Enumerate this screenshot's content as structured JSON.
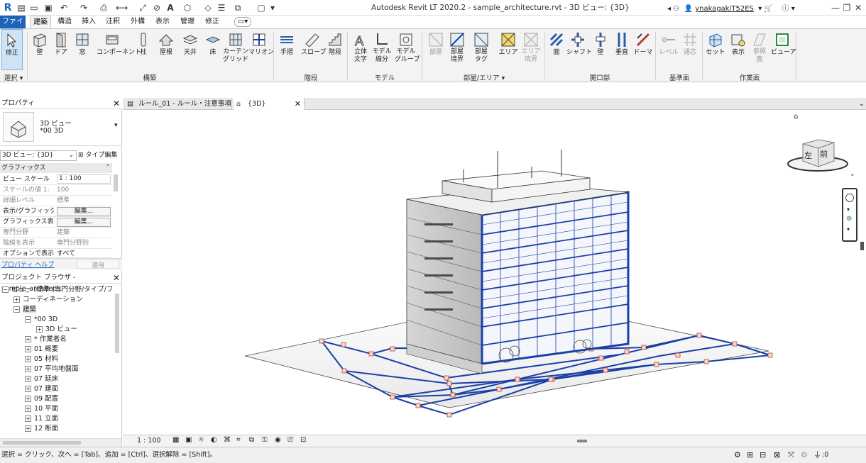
{
  "titlebar": {
    "app_title": "Autodesk Revit LT 2020.2 - sample_architecture.rvt - 3D ビュー: {3D}",
    "user_name": "ynakagakiT52ES"
  },
  "ribbon_tabs": [
    "ファイル",
    "建築",
    "構造",
    "挿入",
    "注釈",
    "外構",
    "表示",
    "管理",
    "修正"
  ],
  "ribbon": {
    "select": {
      "label": "修正",
      "panel": "選択"
    },
    "build": {
      "panel": "構築",
      "buttons": [
        "壁",
        "ドア",
        "窓",
        "コンポーネント",
        "柱",
        "屋根",
        "天井",
        "床",
        "カーテン\nグリッド",
        "マリオン"
      ]
    },
    "circulation": {
      "panel": "階段",
      "buttons": [
        "手摺",
        "スロープ",
        "階段"
      ]
    },
    "model": {
      "panel": "モデル",
      "buttons": [
        "立体\n文字",
        "モデル\n線分",
        "モデル\nグループ"
      ]
    },
    "room": {
      "panel": "部屋/エリア",
      "buttons": [
        "部屋",
        "部屋\n境界",
        "部屋\nタグ",
        "エリア",
        "エリア\n境界"
      ]
    },
    "opening": {
      "panel": "開口部",
      "buttons": [
        "面",
        "シャフト",
        "壁",
        "垂直",
        "ドーマ"
      ]
    },
    "datum": {
      "panel": "基準面",
      "buttons": [
        "レベル",
        "通芯"
      ]
    },
    "workplane": {
      "panel": "作業面",
      "buttons": [
        "セット",
        "表示",
        "参照\n面",
        "ビューア"
      ]
    }
  },
  "properties": {
    "title": "プロパティ",
    "type_name_line1": "3D ビュー",
    "type_name_line2": "*00 3D",
    "view_selector": "3D ビュー: {3D}",
    "edit_type": "タイプ編集",
    "section": "グラフィックス",
    "rows": [
      {
        "key": "ビュー スケール",
        "value": "1 : 100"
      },
      {
        "key": "スケールの値   1:",
        "value": "100"
      },
      {
        "key": "詳細レベル",
        "value": "標準"
      },
      {
        "key": "表示/グラフィック...",
        "value": "編集..."
      },
      {
        "key": "グラフィックス表示...",
        "value": "編集..."
      },
      {
        "key": "専門分野",
        "value": "建築"
      },
      {
        "key": "陰線を表示",
        "value": "専門分野別"
      },
      {
        "key": "オプションで表示",
        "value": "すべて"
      }
    ],
    "help_link": "プロパティ ヘルプ",
    "apply": "適用"
  },
  "browser": {
    "title": "プロジェクト ブラウザ - sample_architec...",
    "items": [
      {
        "label": "ビュー (標準 (専門分野/タイプ/フ",
        "level": 0,
        "toggle": "-"
      },
      {
        "label": "コーディネーション",
        "level": 1,
        "toggle": "+"
      },
      {
        "label": "建築",
        "level": 1,
        "toggle": "-"
      },
      {
        "label": "*00 3D",
        "level": 2,
        "toggle": "-"
      },
      {
        "label": "3D ビュー",
        "level": 3,
        "toggle": "+"
      },
      {
        "label": "* 作業者名",
        "level": 2,
        "toggle": "+"
      },
      {
        "label": "01 概要",
        "level": 2,
        "toggle": "+"
      },
      {
        "label": "05 材料",
        "level": 2,
        "toggle": "+"
      },
      {
        "label": "07 平均地盤面",
        "level": 2,
        "toggle": "+"
      },
      {
        "label": "07 延床",
        "level": 2,
        "toggle": "+"
      },
      {
        "label": "07 建面",
        "level": 2,
        "toggle": "+"
      },
      {
        "label": "09 配置",
        "level": 2,
        "toggle": "+"
      },
      {
        "label": "10 平面",
        "level": 2,
        "toggle": "+"
      },
      {
        "label": "11 立面",
        "level": 2,
        "toggle": "+"
      },
      {
        "label": "12 断面",
        "level": 2,
        "toggle": "+"
      }
    ]
  },
  "view_tabs": [
    {
      "label": "ルール_01 - ルール・注意事項"
    },
    {
      "label": "{3D}"
    }
  ],
  "viewcube": {
    "left": "左",
    "front": "前"
  },
  "viewbar": {
    "scale": "1 : 100"
  },
  "status": {
    "message": "選択 = クリック、次へ = [Tab]、追加 = [Ctrl]、選択解除 = [Shift]。",
    "filter_count": ":0"
  },
  "colors": {
    "file_tab": "#1d63b8",
    "selection_blue": "#1a3fa8",
    "ribbon_bg": "#f3f3f3"
  }
}
